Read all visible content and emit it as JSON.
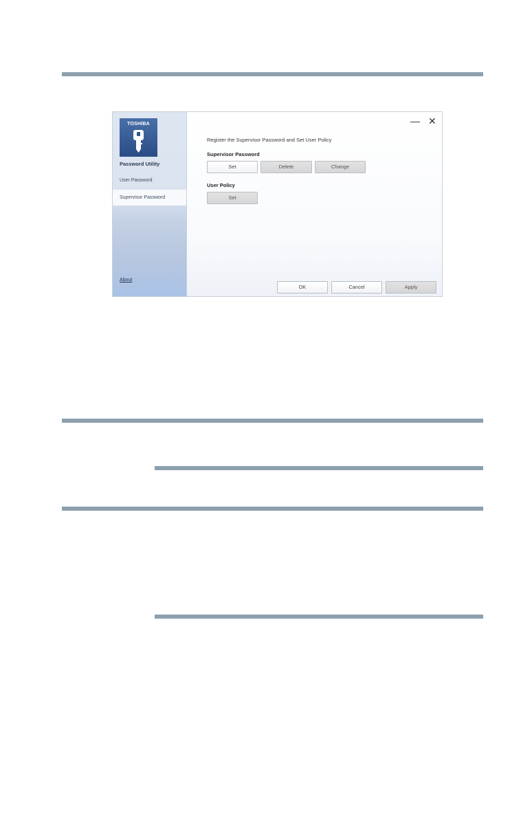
{
  "app": {
    "brand": "TOSHIBA",
    "title": "Password Utility",
    "window_controls": {
      "minimize": "—",
      "close": "✕"
    }
  },
  "sidebar": {
    "items": [
      {
        "label": "User Password",
        "selected": false
      },
      {
        "label": "Supervisor Password",
        "selected": true
      }
    ],
    "about_link": "About"
  },
  "main": {
    "heading": "Register the Supervisor Password and Set User Policy",
    "supervisor_section": {
      "label": "Supervisor Password",
      "buttons": {
        "set": "Set",
        "delete": "Delete",
        "change": "Change"
      }
    },
    "user_policy_section": {
      "label": "User Policy",
      "buttons": {
        "set": "Set"
      }
    }
  },
  "footer": {
    "ok": "OK",
    "cancel": "Cancel",
    "apply": "Apply"
  },
  "colors": {
    "rule": "#8da0ae",
    "logo_tile": "#2a4c86",
    "sidebar": "#dae3ef"
  }
}
